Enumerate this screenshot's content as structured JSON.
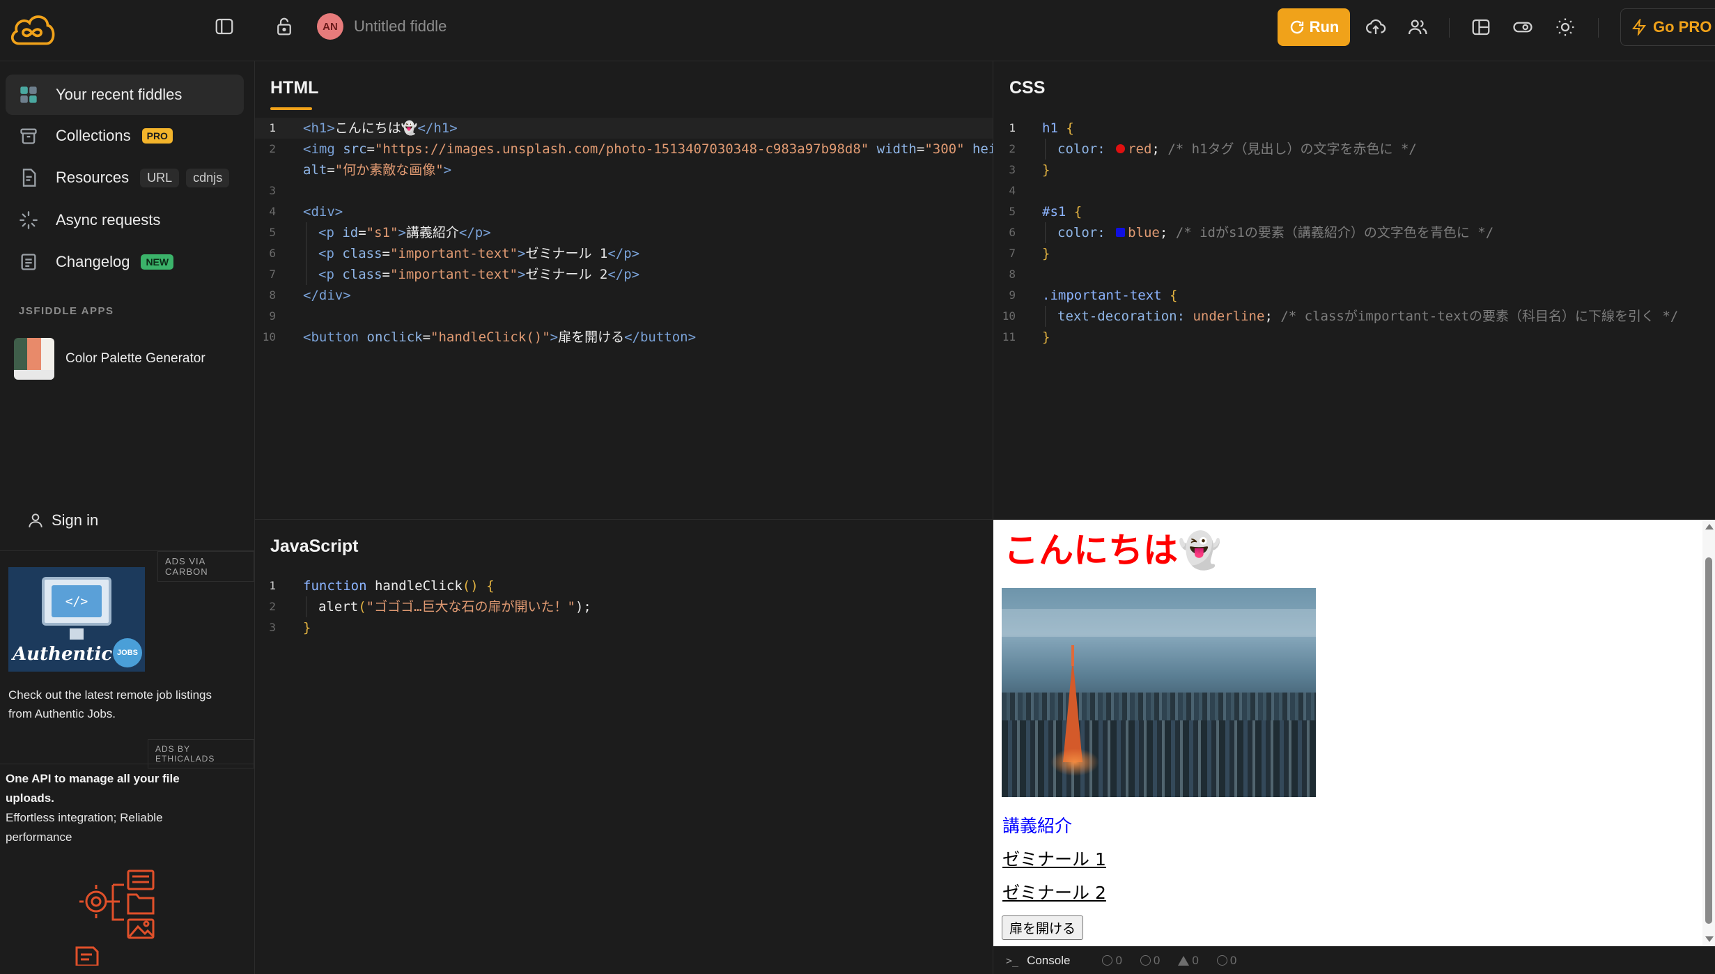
{
  "header": {
    "fiddle_title": "Untitled fiddle",
    "avatar_initials": "AN",
    "run_label": "Run",
    "go_pro_label": "Go PRO"
  },
  "sidebar": {
    "items": [
      {
        "label": "Your recent fiddles",
        "icon": "grid-icon"
      },
      {
        "label": "Collections",
        "icon": "box-icon",
        "badge": "PRO"
      },
      {
        "label": "Resources",
        "icon": "file-icon",
        "tags": [
          "URL",
          "cdnjs"
        ]
      },
      {
        "label": "Async requests",
        "icon": "spinner-icon"
      },
      {
        "label": "Changelog",
        "icon": "list-icon",
        "badge": "NEW"
      }
    ],
    "apps_heading": "JSFIDDLE APPS",
    "apps": [
      {
        "label": "Color Palette Generator"
      }
    ],
    "sign_in": "Sign in",
    "ads": {
      "carbon_label": "ADS VIA CARBON",
      "carbon_text": "Check out the latest remote job listings from Authentic Jobs.",
      "carbon_logo_text": "Authentic",
      "carbon_jobs": "JOBS",
      "ethical_label": "ADS BY ETHICALADS",
      "ethical_title": "One API to manage all your file uploads.",
      "ethical_text": "Effortless integration; Reliable performance"
    }
  },
  "panels": {
    "html": {
      "title": "HTML",
      "line_numbers": [
        "1",
        "2",
        "",
        "3",
        "4",
        "5",
        "6",
        "7",
        "8",
        "9",
        "10"
      ]
    },
    "css": {
      "title": "CSS",
      "line_numbers": [
        "1",
        "2",
        "3",
        "4",
        "5",
        "6",
        "7",
        "8",
        "9",
        "10",
        "11"
      ]
    },
    "js": {
      "title": "JavaScript",
      "line_numbers": [
        "1",
        "2",
        "3"
      ]
    }
  },
  "code": {
    "html": {
      "l1": [
        "<h1>",
        "こんにちは👻",
        "</h1>"
      ],
      "l2": [
        "<img ",
        "src",
        "=",
        "\"https://images.unsplash.com/photo-1513407030348-c983a97b98d8\"",
        " ",
        "width",
        "=",
        "\"300\"",
        " ",
        "heigh"
      ],
      "l2b": [
        "alt",
        "=",
        "\"何か素敵な画像\"",
        ">"
      ],
      "l4": "<div>",
      "l5": [
        "<p ",
        "id",
        "=",
        "\"s1\"",
        ">",
        "講義紹介",
        "</p>"
      ],
      "l6": [
        "<p ",
        "class",
        "=",
        "\"important-text\"",
        ">",
        "ゼミナール 1",
        "</p>"
      ],
      "l7": [
        "<p ",
        "class",
        "=",
        "\"important-text\"",
        ">",
        "ゼミナール 2",
        "</p>"
      ],
      "l8": "</div>",
      "l10": [
        "<button ",
        "onclick",
        "=",
        "\"handleClick()\"",
        ">",
        "扉を開ける",
        "</button>"
      ]
    },
    "css": {
      "l1": [
        "h1",
        " {"
      ],
      "l2": [
        "color:",
        "red",
        ";",
        "/* h1タグ（見出し）の文字を赤色に */"
      ],
      "l3": "}",
      "l5": [
        "#s1",
        " {"
      ],
      "l6": [
        "color:",
        "blue",
        ";",
        "/* idがs1の要素（講義紹介）の文字色を青色に */"
      ],
      "l7": "}",
      "l9": [
        ".important-text",
        " {"
      ],
      "l10": [
        "text-decoration:",
        "underline",
        ";",
        "/* classがimportant-textの要素（科目名）に下線を引く */"
      ],
      "l11": "}",
      "swatch_red": "#e01010",
      "swatch_blue": "#1010e0"
    },
    "js": {
      "l1": [
        "function",
        " handleClick",
        "()",
        " {"
      ],
      "l2": [
        "alert",
        "(",
        "\"ゴゴゴ…巨大な石の扉が開いた！\"",
        ");"
      ],
      "l3": "}"
    }
  },
  "preview": {
    "h1": "こんにちは👻",
    "p_s1": "講義紹介",
    "p1": "ゼミナール 1",
    "p2": "ゼミナール 2",
    "button": "扉を開ける"
  },
  "status": {
    "console": "Console",
    "counts": [
      "0",
      "0",
      "0",
      "0"
    ]
  },
  "colors": {
    "accent": "#f0a21a",
    "pro_badge": "#f3b42b",
    "new_badge": "#3bb36a"
  }
}
